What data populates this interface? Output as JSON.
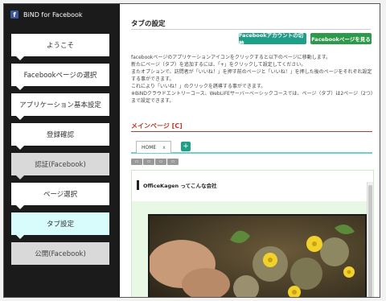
{
  "app": {
    "title": "BiND for Facebook"
  },
  "nav": {
    "items": [
      {
        "label": "ようこそ",
        "state": "normal"
      },
      {
        "label": "Facebookページの選択",
        "state": "normal"
      },
      {
        "label": "アプリケーション基本設定",
        "state": "normal"
      },
      {
        "label": "登録確認",
        "state": "normal"
      },
      {
        "label": "認証(Facebook)",
        "state": "done"
      },
      {
        "label": "ページ選択",
        "state": "normal"
      },
      {
        "label": "タブ設定",
        "state": "active"
      },
      {
        "label": "公開(Facebook)",
        "state": "done"
      }
    ]
  },
  "main": {
    "title": "タブの設定",
    "buttons": {
      "account": "Facebookアカウントの切替",
      "page": "Facebookページを見る"
    },
    "description": [
      "facebookページのアプリケーションアイコンをクリックすると以下のページに移動します。",
      "新たにページ（タブ）を追加するには、「+」をクリックして設定してください。",
      "またオプションで、訪問者が「いいね！」を押す前のページと「いいね！」を押した後のページをそれぞれ設定する事ができます。",
      "これにより「いいね！」のクリックを誘導する事ができます。",
      "※BiNDクラウドエントリーコース、WebLiFEサーバーベーシックコースでは、ページ（タブ）は2ページ（2つ）まで設定できます。"
    ],
    "section_title": "メインページ [C]",
    "tabs": [
      {
        "label": "HOME",
        "close": "x"
      }
    ],
    "add_tab_label": "+",
    "canvas_heading": "OfficeKagen ってこんな会社"
  },
  "colors": {
    "sidebar_bg": "#1b1b1b",
    "active_nav": "#d8fbfb",
    "done_nav": "#d9d9d9",
    "accent_teal": "#1f9e88",
    "accent_green": "#2c9a4a",
    "section_red": "#c0392b"
  },
  "icons": {
    "brand": "facebook-f-icon",
    "tab_close": "close-icon",
    "tab_add": "plus-icon"
  }
}
